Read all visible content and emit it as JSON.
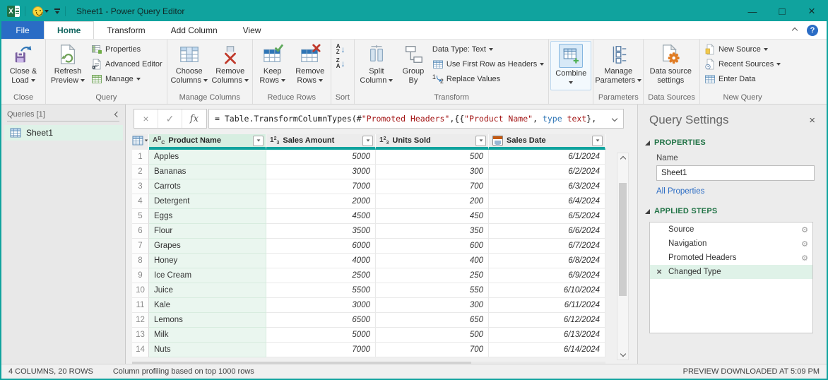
{
  "window": {
    "title": "Sheet1 - Power Query Editor"
  },
  "glyphs": {
    "minimize": "—",
    "maximize": "□",
    "close": "×",
    "help": "?",
    "cancel": "×",
    "check": "✓",
    "fx": "fx",
    "A": "A",
    "B": "B",
    "C": "C",
    "one": "1",
    "two": "2",
    "three": "3",
    "Z": "Z",
    "down_arrow": "↓",
    "gear": "⚙",
    "delete_x": "×"
  },
  "tabs": {
    "file": "File",
    "items": [
      "Home",
      "Transform",
      "Add Column",
      "View"
    ],
    "selected": "Home"
  },
  "ribbon": {
    "close_load_1": "Close &",
    "close_load_2": "Load",
    "group_close": "Close",
    "refresh_1": "Refresh",
    "refresh_2": "Preview",
    "properties": "Properties",
    "advanced_editor": "Advanced Editor",
    "manage": "Manage",
    "group_query": "Query",
    "choose_1": "Choose",
    "choose_2": "Columns",
    "removec_1": "Remove",
    "removec_2": "Columns",
    "group_manage_columns": "Manage Columns",
    "keep_1": "Keep",
    "keep_2": "Rows",
    "remover_1": "Remove",
    "remover_2": "Rows",
    "group_reduce_rows": "Reduce Rows",
    "group_sort": "Sort",
    "split_1": "Split",
    "split_2": "Column",
    "groupby_1": "Group",
    "groupby_2": "By",
    "data_type": "Data Type: Text",
    "use_first_row": "Use First Row as Headers",
    "replace_values": "Replace Values",
    "group_transform": "Transform",
    "combine": "Combine",
    "group_combine": "",
    "managep_1": "Manage",
    "managep_2": "Parameters",
    "group_parameters": "Parameters",
    "dss_1": "Data source",
    "dss_2": "settings",
    "group_data_sources": "Data Sources",
    "new_source": "New Source",
    "recent_sources": "Recent Sources",
    "enter_data": "Enter Data",
    "group_new_query": "New Query"
  },
  "queries_pane": {
    "header": "Queries [1]",
    "items": [
      {
        "name": "Sheet1"
      }
    ]
  },
  "formula_bar": {
    "segments": [
      {
        "t": "= Table.TransformColumnTypes(#",
        "c": "plain"
      },
      {
        "t": "\"Promoted Headers\"",
        "c": "string"
      },
      {
        "t": ",{{",
        "c": "plain"
      },
      {
        "t": "\"Product Name\"",
        "c": "string"
      },
      {
        "t": ", ",
        "c": "plain"
      },
      {
        "t": "type",
        "c": "keyword"
      },
      {
        "t": " ",
        "c": "plain"
      },
      {
        "t": "text",
        "c": "string"
      },
      {
        "t": "},",
        "c": "plain"
      }
    ]
  },
  "table": {
    "columns": [
      {
        "name": "Product Name",
        "type": "text"
      },
      {
        "name": "Sales Amount",
        "type": "number"
      },
      {
        "name": "Units Sold",
        "type": "number"
      },
      {
        "name": "Sales Date",
        "type": "date"
      }
    ],
    "rows": [
      {
        "n": "1",
        "product": "Apples",
        "amount": "5000",
        "units": "500",
        "date": "6/1/2024"
      },
      {
        "n": "2",
        "product": "Bananas",
        "amount": "3000",
        "units": "300",
        "date": "6/2/2024"
      },
      {
        "n": "3",
        "product": "Carrots",
        "amount": "7000",
        "units": "700",
        "date": "6/3/2024"
      },
      {
        "n": "4",
        "product": "Detergent",
        "amount": "2000",
        "units": "200",
        "date": "6/4/2024"
      },
      {
        "n": "5",
        "product": "Eggs",
        "amount": "4500",
        "units": "450",
        "date": "6/5/2024"
      },
      {
        "n": "6",
        "product": "Flour",
        "amount": "3500",
        "units": "350",
        "date": "6/6/2024"
      },
      {
        "n": "7",
        "product": "Grapes",
        "amount": "6000",
        "units": "600",
        "date": "6/7/2024"
      },
      {
        "n": "8",
        "product": "Honey",
        "amount": "4000",
        "units": "400",
        "date": "6/8/2024"
      },
      {
        "n": "9",
        "product": "Ice Cream",
        "amount": "2500",
        "units": "250",
        "date": "6/9/2024"
      },
      {
        "n": "10",
        "product": "Juice",
        "amount": "5500",
        "units": "550",
        "date": "6/10/2024"
      },
      {
        "n": "11",
        "product": "Kale",
        "amount": "3000",
        "units": "300",
        "date": "6/11/2024"
      },
      {
        "n": "12",
        "product": "Lemons",
        "amount": "6500",
        "units": "650",
        "date": "6/12/2024"
      },
      {
        "n": "13",
        "product": "Milk",
        "amount": "5000",
        "units": "500",
        "date": "6/13/2024"
      },
      {
        "n": "14",
        "product": "Nuts",
        "amount": "7000",
        "units": "700",
        "date": "6/14/2024"
      }
    ]
  },
  "query_settings": {
    "title": "Query Settings",
    "properties_header": "PROPERTIES",
    "name_label": "Name",
    "name_value": "Sheet1",
    "all_properties": "All Properties",
    "applied_steps_header": "APPLIED STEPS",
    "steps": [
      {
        "name": "Source",
        "gear": true,
        "selected": false
      },
      {
        "name": "Navigation",
        "gear": true,
        "selected": false
      },
      {
        "name": "Promoted Headers",
        "gear": true,
        "selected": false
      },
      {
        "name": "Changed Type",
        "gear": false,
        "selected": true
      }
    ]
  },
  "status_bar": {
    "left1": "4 COLUMNS, 20 ROWS",
    "left2": "Column profiling based on top 1000 rows",
    "right": "PREVIEW DOWNLOADED AT 5:09 PM"
  },
  "colors": {
    "accent_teal": "#10A39E",
    "selection_green": "#DFF2E8",
    "file_tab_blue": "#2A6CC5",
    "section_green": "#217346",
    "link_blue": "#2B6CC4",
    "string_red": "#A31515",
    "keyword_blue": "#2E75B6"
  }
}
